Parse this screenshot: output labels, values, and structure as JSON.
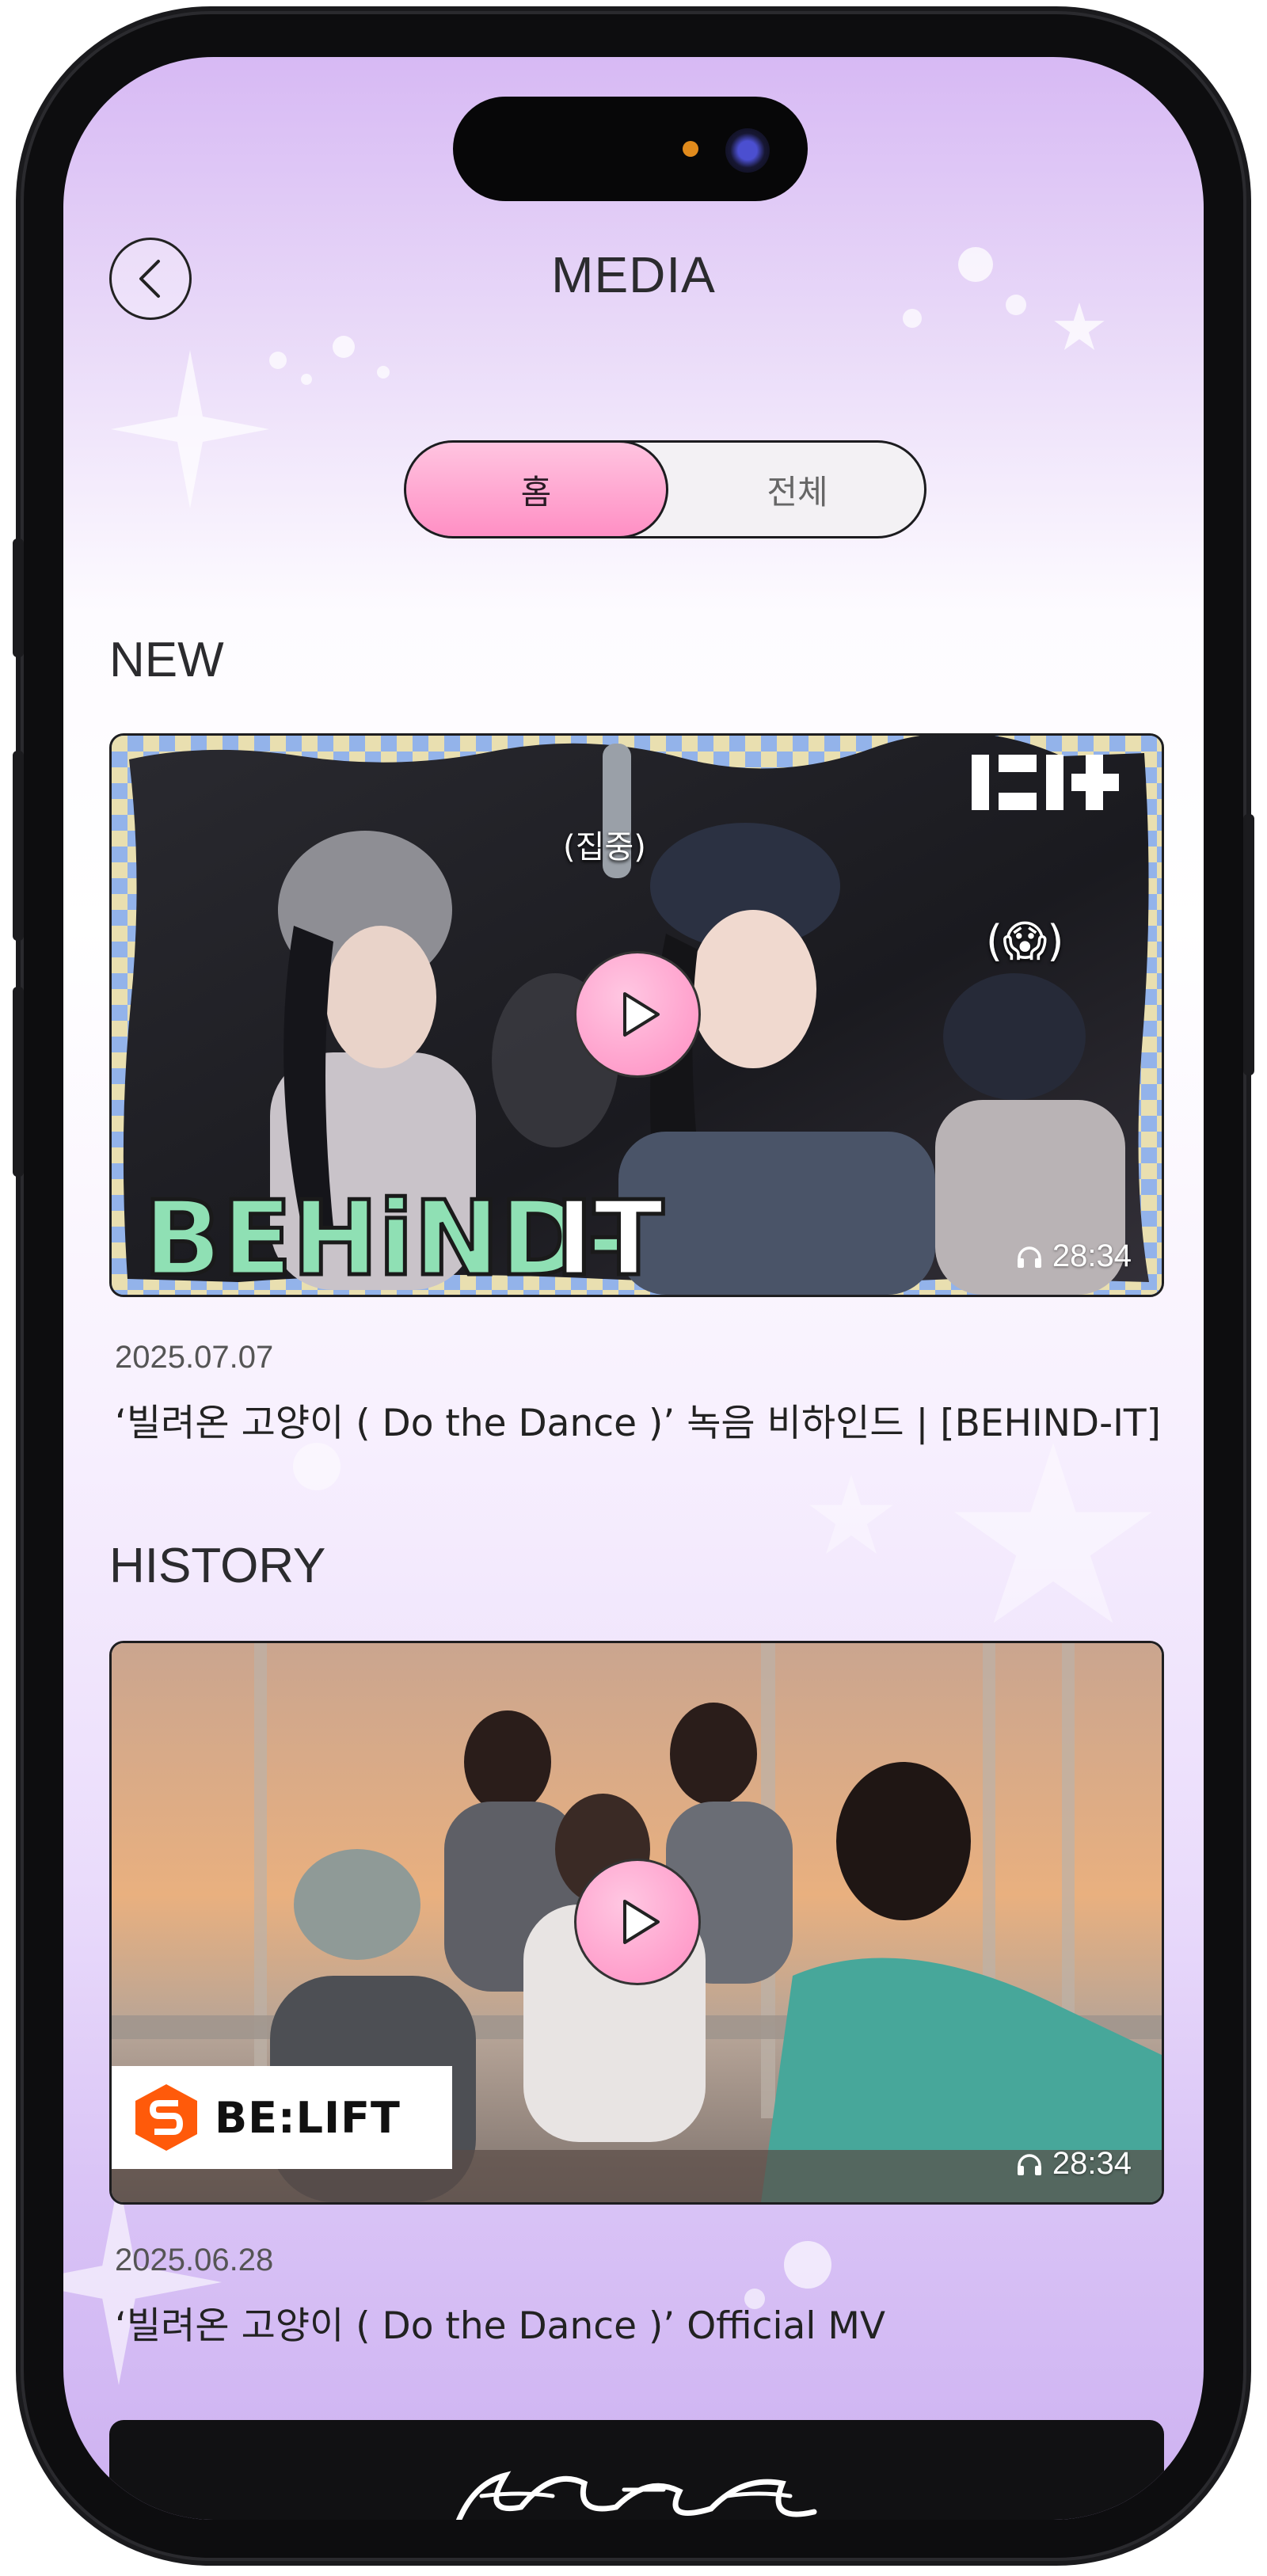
{
  "header": {
    "title": "MEDIA",
    "back_icon": "chevron-left-icon"
  },
  "tabs": [
    {
      "label": "홈",
      "active": true
    },
    {
      "label": "전체",
      "active": false
    }
  ],
  "sections": {
    "new": {
      "heading": "NEW",
      "video": {
        "date": "2025.07.07",
        "title": "‘빌려온 고양이 ( Do the Dance )’ 녹음 비하인드 | [BEHIND-IT]",
        "duration": "28:34",
        "overlay_caption": "(집중)",
        "overlay_emoji": "(😱)",
        "overlay_brand": "BEHIND-IT"
      }
    },
    "history": {
      "heading": "HISTORY",
      "video": {
        "date": "2025.06.28",
        "title": "‘빌려온 고양이 ( Do the Dance )’  Official MV",
        "duration": "28:34",
        "logo_text": "BE:LIFT"
      }
    }
  },
  "colors": {
    "accent_pink": "#ff8fc4",
    "bg_lavender": "#d7b9f4",
    "text_dark": "#2b2b2e"
  }
}
